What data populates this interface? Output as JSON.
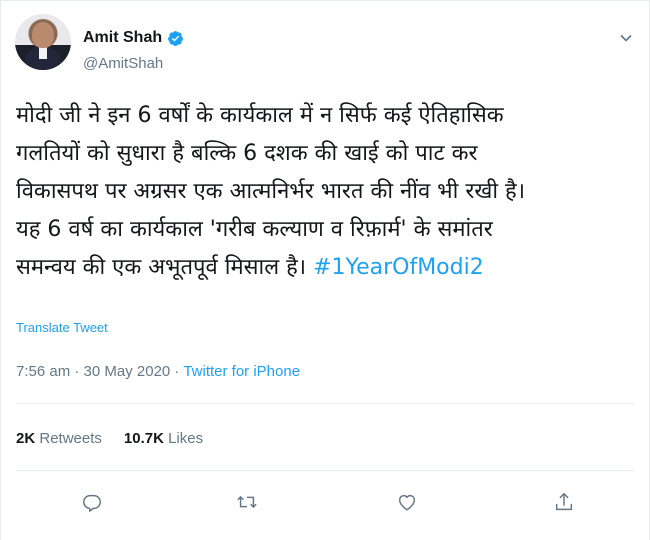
{
  "tweet": {
    "author": {
      "display_name": "Amit Shah",
      "handle": "@AmitShah",
      "verified": true
    },
    "text_lines": [
      "मोदी जी ने इन 6 वर्षों के कार्यकाल में न सिर्फ कई ऐतिहासिक",
      "गलतियों को सुधारा है बल्कि 6 दशक की खाई को पाट कर",
      "विकासपथ पर अग्रसर एक आत्मनिर्भर भारत की नींव भी रखी है।",
      "यह 6 वर्ष का कार्यकाल 'गरीब कल्याण व रिफ़ार्म' के समांतर",
      "समन्वय की एक अभूतपूर्व मिसाल है।"
    ],
    "hashtag": "#1YearOfModi2",
    "translate_label": "Translate Tweet",
    "timestamp": "7:56 am · 30 May 2020 · ",
    "source": "Twitter for iPhone",
    "stats": {
      "retweets_count": "2K",
      "retweets_label": "Retweets",
      "likes_count": "10.7K",
      "likes_label": "Likes"
    }
  },
  "icons": {
    "verified": "verified-badge-icon",
    "menu": "chevron-down-icon",
    "reply": "reply-icon",
    "retweet": "retweet-icon",
    "like": "heart-icon",
    "share": "share-icon"
  },
  "colors": {
    "accent": "#1da1f2",
    "text": "#14171a",
    "secondary": "#657786",
    "divider": "#e6ecf0"
  }
}
